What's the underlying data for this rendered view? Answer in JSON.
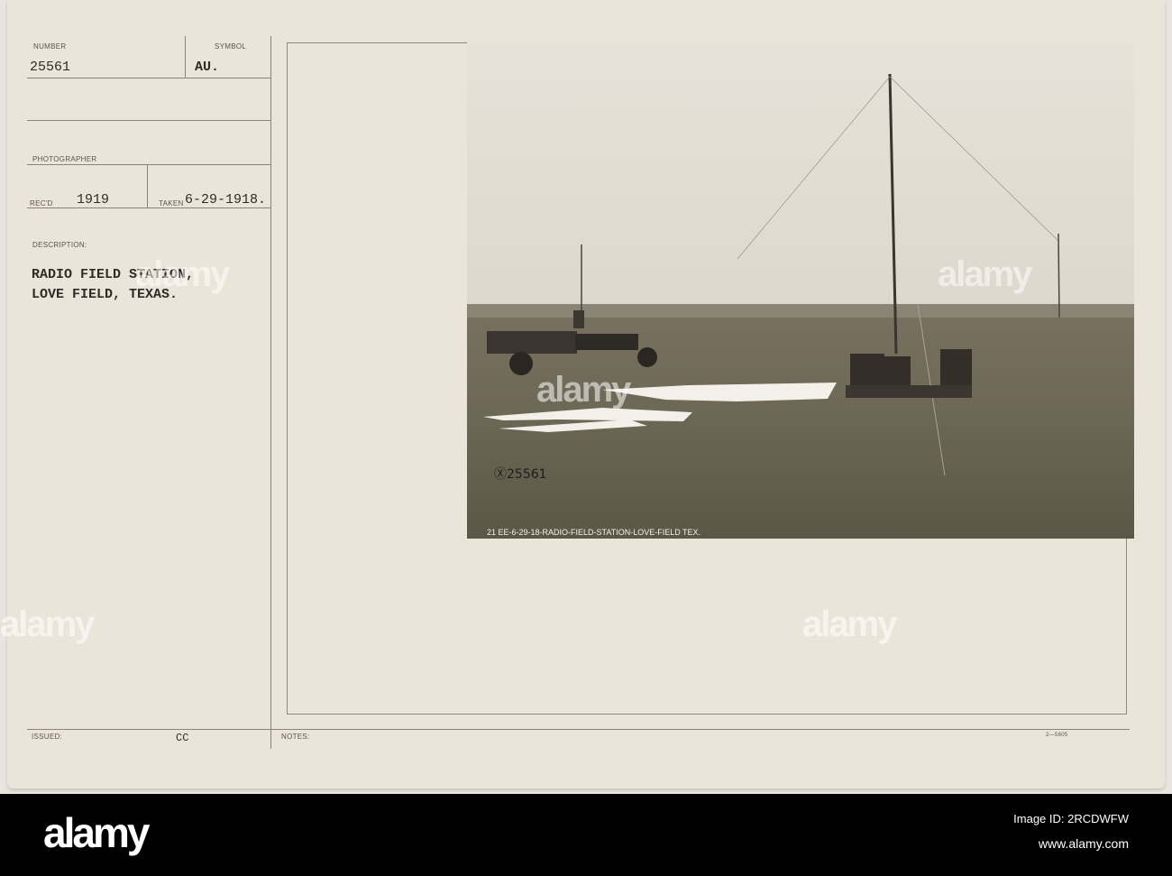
{
  "card": {
    "number_label": "NUMBER",
    "number_value": "25561",
    "symbol_label": "SYMBOL",
    "symbol_value": "AU.",
    "photographer_label": "PHOTOGRAPHER",
    "recd_label": "REC'D",
    "recd_value": "1919",
    "taken_label": "TAKEN",
    "taken_value": "6-29-1918.",
    "description_label": "DESCRIPTION:",
    "description_lines": [
      "RADIO FIELD STATION,",
      "LOVE FIELD, TEXAS."
    ],
    "issued_label": "ISSUED:",
    "issued_value": "CC",
    "notes_label": "NOTES:",
    "form_code": "2—5605"
  },
  "photo": {
    "handwritten_number": "Ⓧ25561",
    "caption": "21 EE-6-29-18-RADIO-FIELD-STATION-LOVE-FIELD TEX."
  },
  "footer": {
    "brand": "alamy",
    "image_id": "Image ID: 2RCDWFW",
    "website": "www.alamy.com"
  },
  "colors": {
    "card": "#ebe4d8",
    "ink": "#2f2b27",
    "band": "#000000"
  }
}
